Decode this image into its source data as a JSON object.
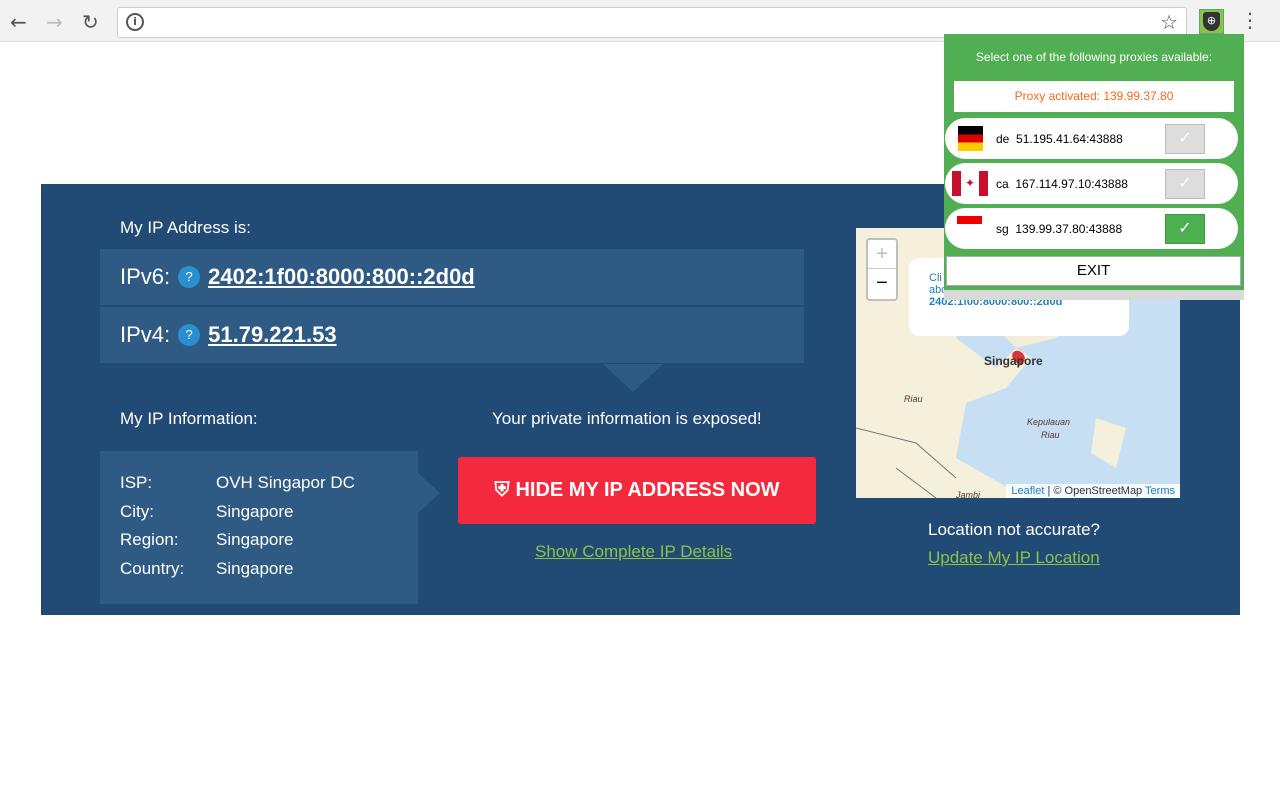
{
  "browser": {
    "back_icon": "arrow-left",
    "forward_icon": "arrow-right",
    "reload_icon": "reload",
    "info_icon": "info",
    "bookmark_icon": "star",
    "extension_icon": "shield-globe",
    "menu_icon": "kebab"
  },
  "main": {
    "ip_heading": "My IP Address is:",
    "ipv6_label": "IPv6:",
    "ipv6_value": "2402:1f00:8000:800::2d0d",
    "ipv4_label": "IPv4:",
    "ipv4_value": "51.79.221.53",
    "help": "?",
    "info_heading": "My IP Information:",
    "info": [
      {
        "k": "ISP:",
        "v": "OVH Singapor DC"
      },
      {
        "k": "City:",
        "v": "Singapore"
      },
      {
        "k": "Region:",
        "v": "Singapore"
      },
      {
        "k": "Country:",
        "v": "Singapore"
      }
    ],
    "exposed": "Your private information is exposed!",
    "hide_button": "HIDE MY IP ADDRESS NOW",
    "details_link": "Show Complete IP Details",
    "location_q": "Location not accurate?",
    "update_link": "Update My IP Location",
    "colors": {
      "panel": "#214a74",
      "button": "#f5293d",
      "link": "#8bc34a"
    }
  },
  "map": {
    "zoom_in": "+",
    "zoom_out": "−",
    "popup_line1": "Cli",
    "popup_line2": "abo",
    "popup_ip": "2402:1f00:8000:800::2d0d",
    "labels": [
      "Singapore",
      "Riau",
      "Kepulauan",
      "Riau",
      "Jambi"
    ],
    "attr_leaflet": "Leaflet",
    "attr_sep": " | © OpenStreetMap ",
    "attr_terms": "Terms"
  },
  "proxy": {
    "title": "Select one of the following proxies available:",
    "activated": "Proxy activated: 139.99.37.80",
    "items": [
      {
        "code": "de",
        "address": "51.195.41.64:43888",
        "selected": false
      },
      {
        "code": "ca",
        "address": "167.114.97.10:43888",
        "selected": false
      },
      {
        "code": "sg",
        "address": "139.99.37.80:43888",
        "selected": true
      }
    ],
    "check": "✓",
    "exit": "EXIT",
    "colors": {
      "bg": "#52ae52",
      "activated": "#f26a1b"
    }
  }
}
